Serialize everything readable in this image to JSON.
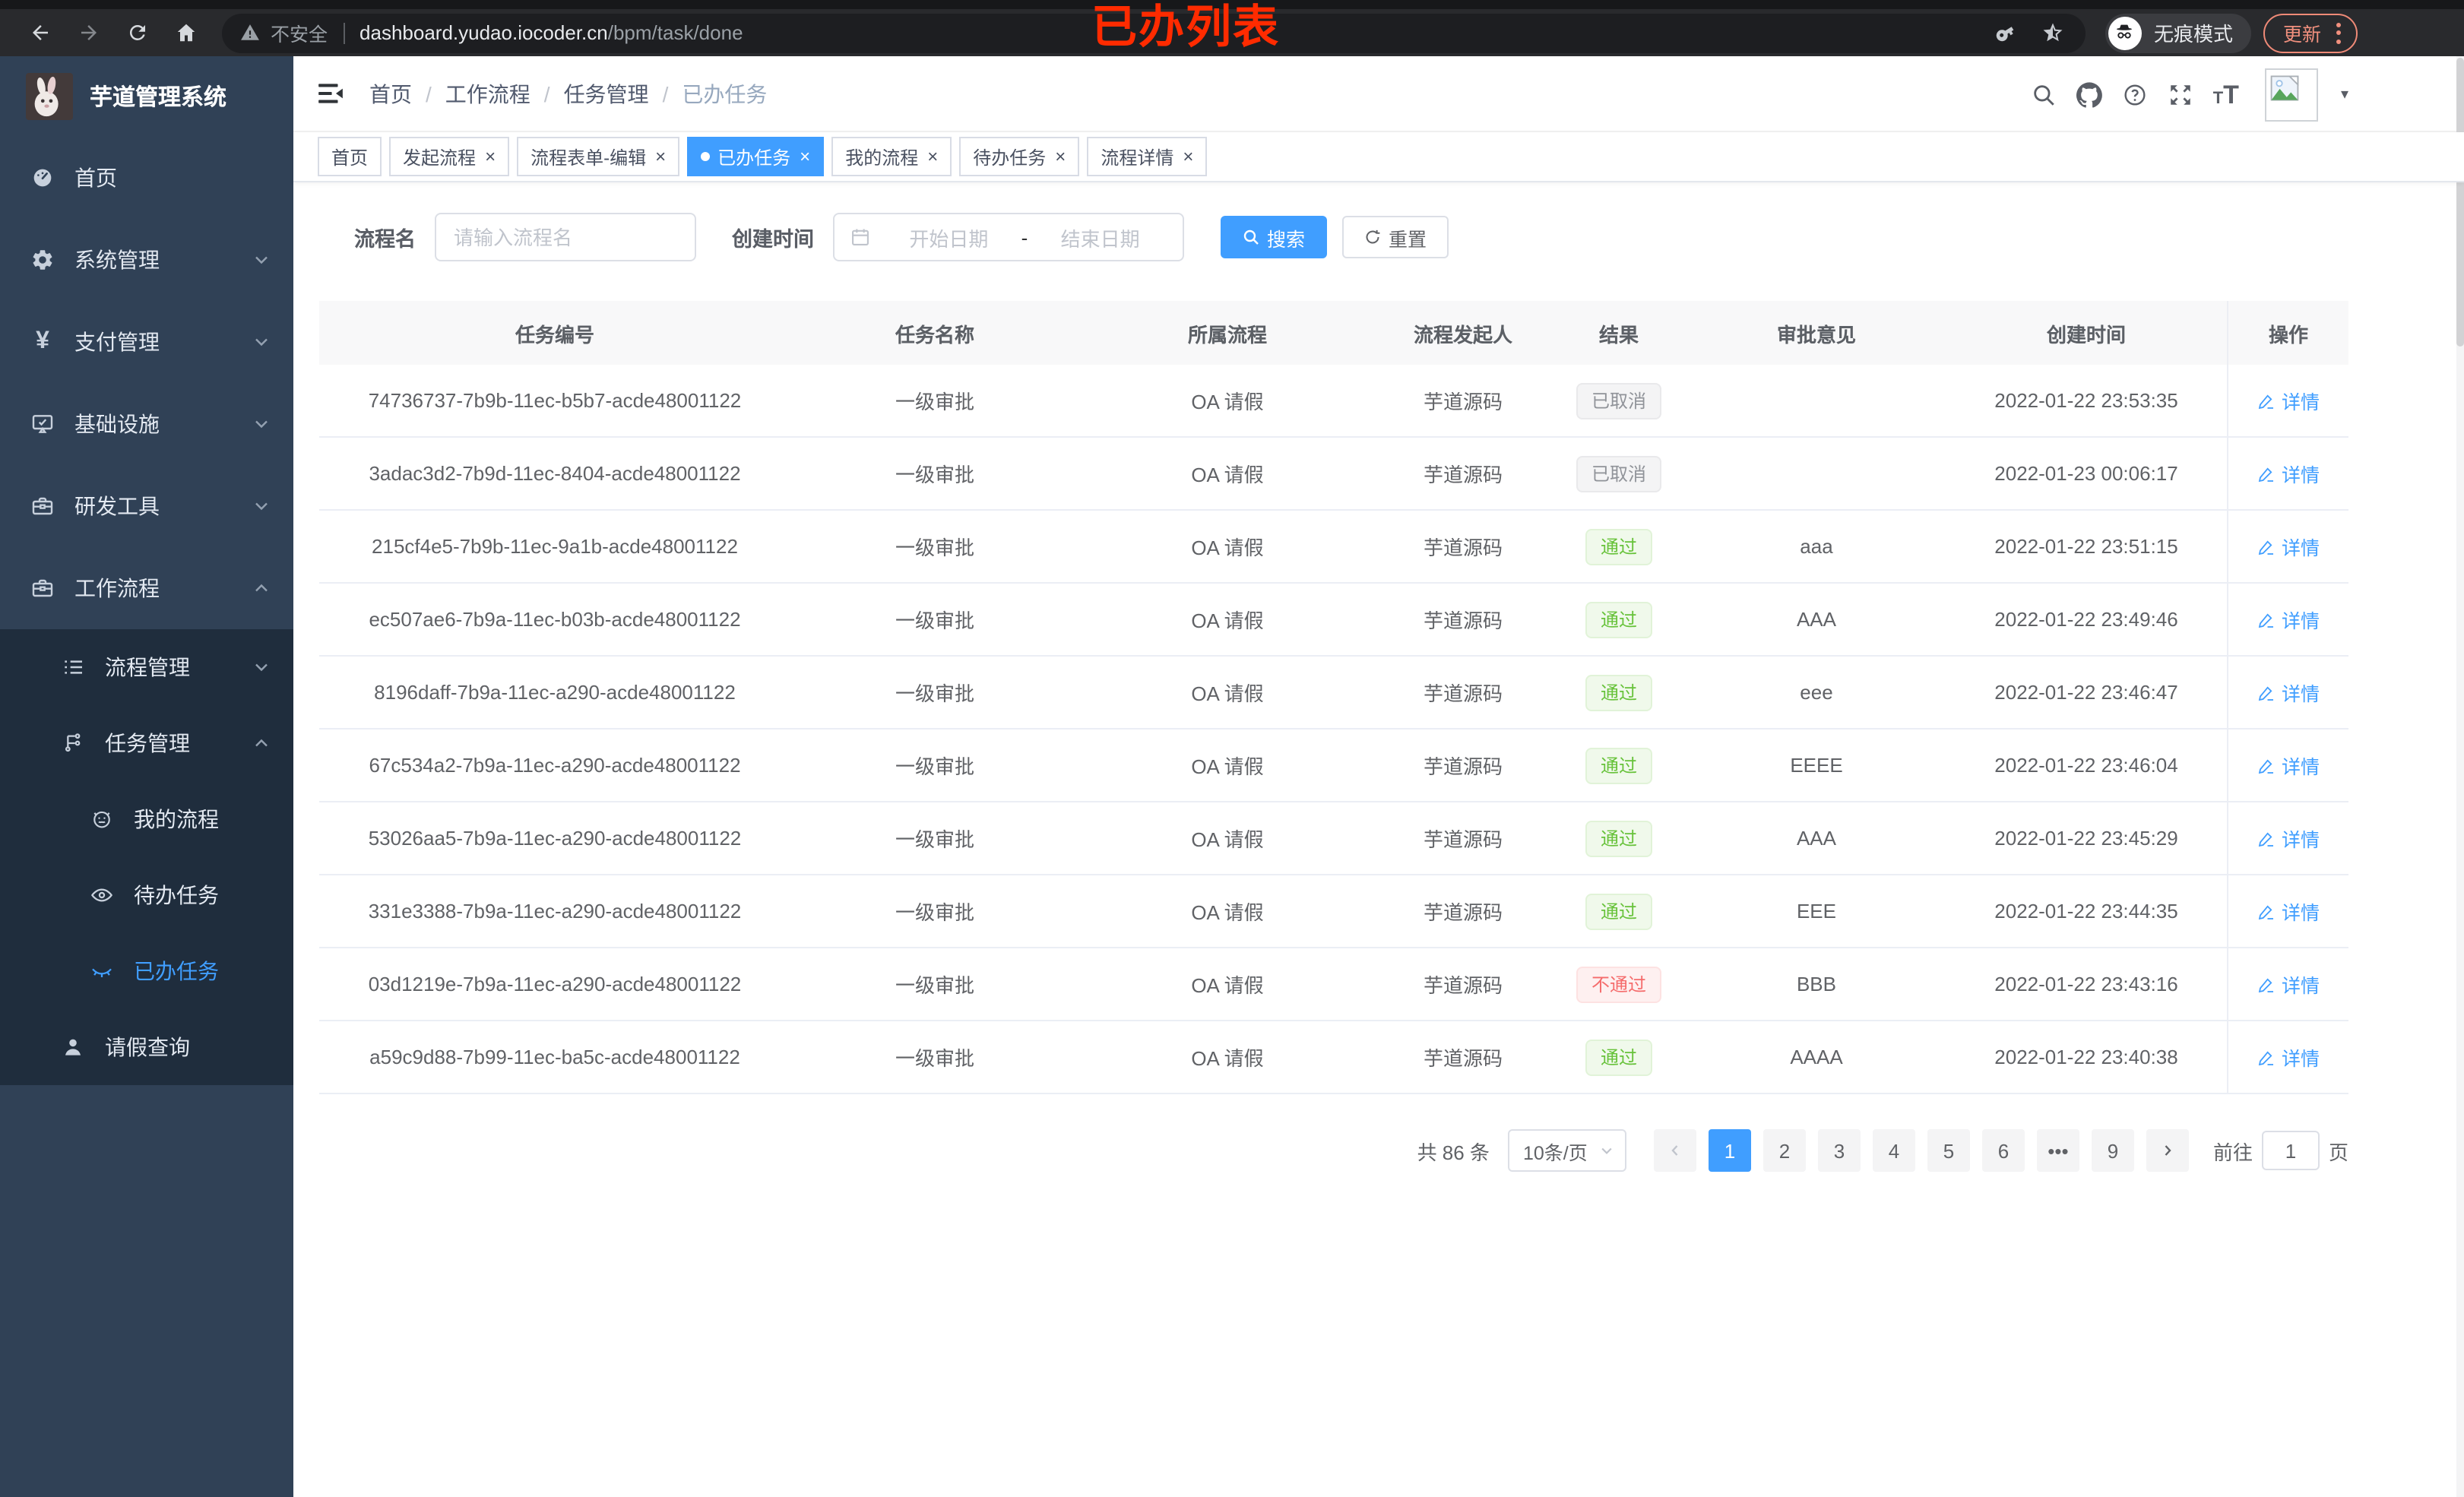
{
  "browser": {
    "security_label": "不安全",
    "url_domain": "dashboard.yudao.iocoder.cn",
    "url_path": "/bpm/task/done",
    "annotation": "已办列表",
    "incognito_label": "无痕模式",
    "update_label": "更新"
  },
  "sidebar": {
    "title": "芋道管理系统",
    "items": [
      {
        "label": "首页"
      },
      {
        "label": "系统管理"
      },
      {
        "label": "支付管理"
      },
      {
        "label": "基础设施"
      },
      {
        "label": "研发工具"
      },
      {
        "label": "工作流程"
      },
      {
        "label": "流程管理"
      },
      {
        "label": "任务管理"
      },
      {
        "label": "我的流程"
      },
      {
        "label": "待办任务"
      },
      {
        "label": "已办任务"
      },
      {
        "label": "请假查询"
      }
    ]
  },
  "navbar": {
    "breadcrumb": [
      {
        "label": "首页"
      },
      {
        "label": "工作流程"
      },
      {
        "label": "任务管理"
      },
      {
        "label": "已办任务"
      }
    ]
  },
  "tabs": [
    {
      "label": "首页"
    },
    {
      "label": "发起流程"
    },
    {
      "label": "流程表单-编辑"
    },
    {
      "label": "已办任务"
    },
    {
      "label": "我的流程"
    },
    {
      "label": "待办任务"
    },
    {
      "label": "流程详情"
    }
  ],
  "filters": {
    "name_label": "流程名",
    "name_placeholder": "请输入流程名",
    "date_label": "创建时间",
    "date_start": "开始日期",
    "date_sep": "-",
    "date_end": "结束日期",
    "search_label": "搜索",
    "reset_label": "重置"
  },
  "table": {
    "columns": [
      "任务编号",
      "任务名称",
      "所属流程",
      "流程发起人",
      "结果",
      "审批意见",
      "创建时间",
      "操作"
    ],
    "action_label": "详情",
    "rows": [
      {
        "id": "74736737-7b9b-11ec-b5b7-acde48001122",
        "name": "一级审批",
        "flow": "OA 请假",
        "starter": "芋道源码",
        "result": "已取消",
        "comment": "",
        "time": "2022-01-22 23:53:35"
      },
      {
        "id": "3adac3d2-7b9d-11ec-8404-acde48001122",
        "name": "一级审批",
        "flow": "OA 请假",
        "starter": "芋道源码",
        "result": "已取消",
        "comment": "",
        "time": "2022-01-23 00:06:17"
      },
      {
        "id": "215cf4e5-7b9b-11ec-9a1b-acde48001122",
        "name": "一级审批",
        "flow": "OA 请假",
        "starter": "芋道源码",
        "result": "通过",
        "comment": "aaa",
        "time": "2022-01-22 23:51:15"
      },
      {
        "id": "ec507ae6-7b9a-11ec-b03b-acde48001122",
        "name": "一级审批",
        "flow": "OA 请假",
        "starter": "芋道源码",
        "result": "通过",
        "comment": "AAA",
        "time": "2022-01-22 23:49:46"
      },
      {
        "id": "8196daff-7b9a-11ec-a290-acde48001122",
        "name": "一级审批",
        "flow": "OA 请假",
        "starter": "芋道源码",
        "result": "通过",
        "comment": "eee",
        "time": "2022-01-22 23:46:47"
      },
      {
        "id": "67c534a2-7b9a-11ec-a290-acde48001122",
        "name": "一级审批",
        "flow": "OA 请假",
        "starter": "芋道源码",
        "result": "通过",
        "comment": "EEEE",
        "time": "2022-01-22 23:46:04"
      },
      {
        "id": "53026aa5-7b9a-11ec-a290-acde48001122",
        "name": "一级审批",
        "flow": "OA 请假",
        "starter": "芋道源码",
        "result": "通过",
        "comment": "AAA",
        "time": "2022-01-22 23:45:29"
      },
      {
        "id": "331e3388-7b9a-11ec-a290-acde48001122",
        "name": "一级审批",
        "flow": "OA 请假",
        "starter": "芋道源码",
        "result": "通过",
        "comment": "EEE",
        "time": "2022-01-22 23:44:35"
      },
      {
        "id": "03d1219e-7b9a-11ec-a290-acde48001122",
        "name": "一级审批",
        "flow": "OA 请假",
        "starter": "芋道源码",
        "result": "不通过",
        "comment": "BBB",
        "time": "2022-01-22 23:43:16"
      },
      {
        "id": "a59c9d88-7b99-11ec-ba5c-acde48001122",
        "name": "一级审批",
        "flow": "OA 请假",
        "starter": "芋道源码",
        "result": "通过",
        "comment": "AAAA",
        "time": "2022-01-22 23:40:38"
      }
    ]
  },
  "pagination": {
    "total": "共 86 条",
    "page_size": "10条/页",
    "pages": [
      "1",
      "2",
      "3",
      "4",
      "5",
      "6",
      "•••",
      "9"
    ],
    "active_page": "1",
    "goto_label": "前往",
    "goto_value": "1",
    "unit_label": "页"
  },
  "colors": {
    "accent": "#409eff",
    "success": "#67c23a",
    "danger": "#f56c6c",
    "info": "#909399",
    "annotation": "#ff2b00",
    "sidebar": "#304156",
    "sidebar_submenu": "#1f2d3d"
  }
}
